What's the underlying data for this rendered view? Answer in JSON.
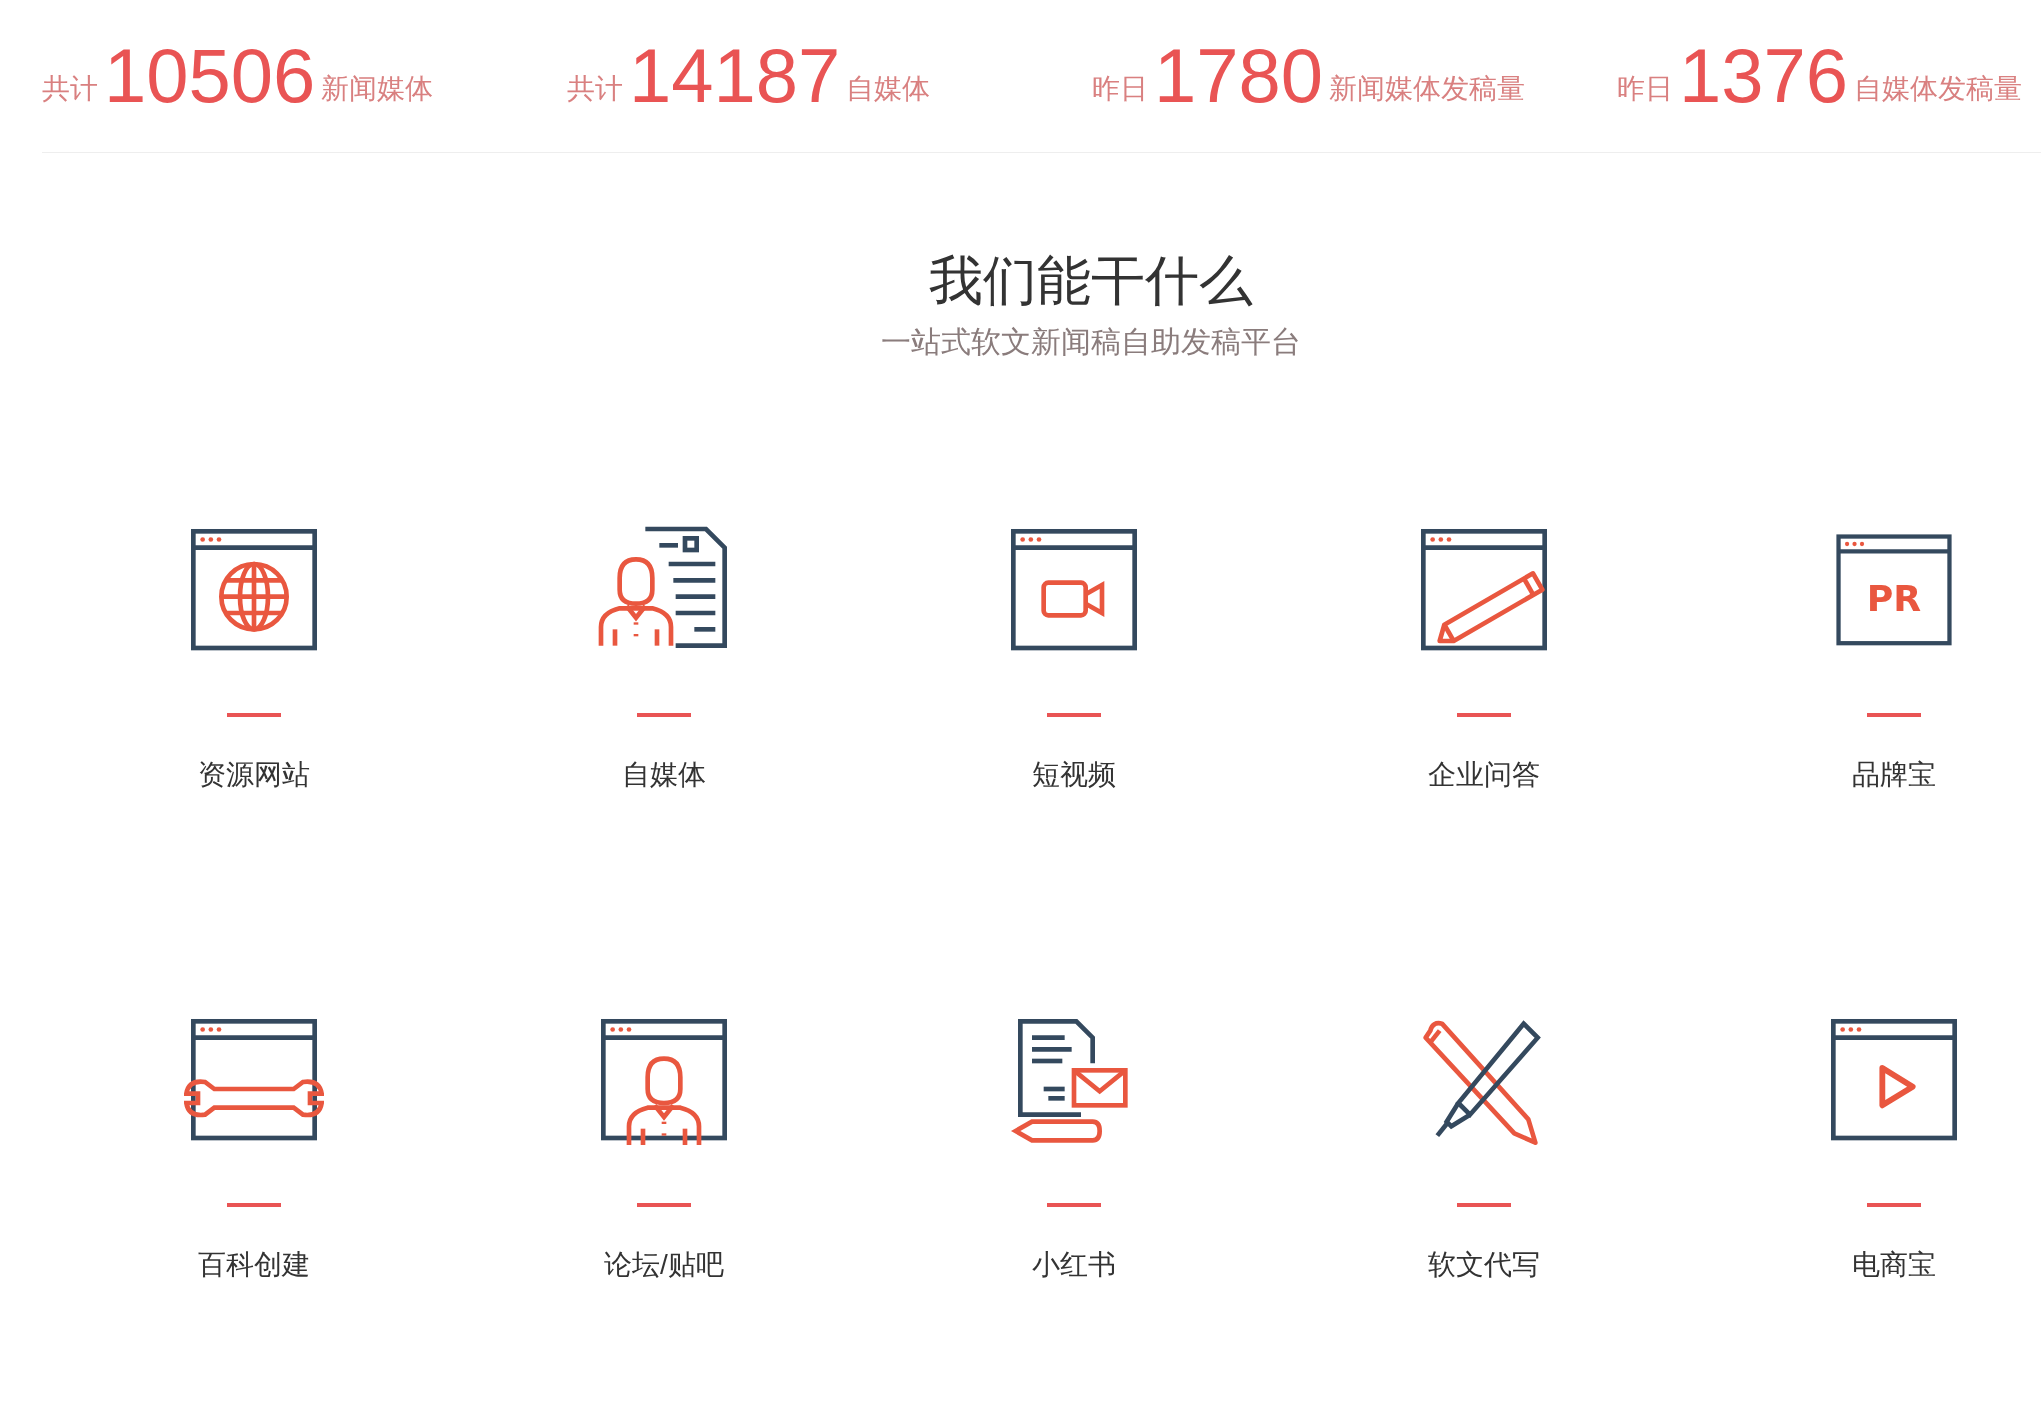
{
  "stats": [
    {
      "prefix": "共计",
      "number": "10506",
      "suffix": "新闻媒体"
    },
    {
      "prefix": "共计",
      "number": "14187",
      "suffix": "自媒体"
    },
    {
      "prefix": "昨日",
      "number": "1780",
      "suffix": "新闻媒体发稿量"
    },
    {
      "prefix": "昨日",
      "number": "1376",
      "suffix": "自媒体发稿量"
    }
  ],
  "section": {
    "title": "我们能干什么",
    "subtitle": "一站式软文新闻稿自助发稿平台"
  },
  "services": [
    {
      "kind": "globe",
      "label": "资源网站"
    },
    {
      "kind": "person",
      "label": "自媒体"
    },
    {
      "kind": "video",
      "label": "短视频"
    },
    {
      "kind": "pencil",
      "label": "企业问答"
    },
    {
      "kind": "pr",
      "icon_text": "PR",
      "label": "品牌宝"
    },
    {
      "kind": "wrench",
      "label": "百科创建"
    },
    {
      "kind": "portrait",
      "label": "论坛/贴吧"
    },
    {
      "kind": "mail",
      "label": "小红书"
    },
    {
      "kind": "pens",
      "label": "软文代写"
    },
    {
      "kind": "play",
      "label": "电商宝"
    }
  ]
}
